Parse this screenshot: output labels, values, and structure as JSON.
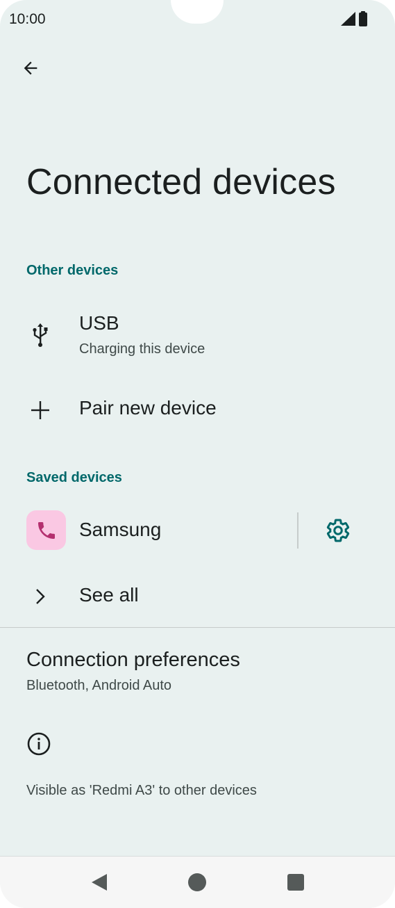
{
  "status_bar": {
    "time": "10:00",
    "icons": [
      "signal-icon",
      "battery-icon"
    ]
  },
  "header": {
    "back_icon": "arrow-left-icon",
    "title": "Connected devices"
  },
  "other_devices": {
    "header": "Other devices",
    "items": [
      {
        "title": "USB",
        "subtitle": "Charging this device",
        "icon": "usb-icon"
      },
      {
        "title": "Pair new device",
        "icon": "plus-icon"
      }
    ]
  },
  "saved_devices": {
    "header": "Saved devices",
    "device": {
      "name": "Samsung",
      "icon": "phone-icon",
      "settings_icon": "gear-icon"
    },
    "see_all": {
      "label": "See all",
      "icon": "chevron-right-icon"
    }
  },
  "connection_preferences": {
    "title": "Connection preferences",
    "subtitle": "Bluetooth, Android Auto"
  },
  "info": {
    "icon": "info-icon",
    "text": "Visible as 'Redmi A3' to other devices"
  },
  "colors": {
    "background": "#e9f1f0",
    "accent": "#00686a",
    "device_icon_bg": "#fac8e3",
    "device_icon_fg": "#b4306f"
  },
  "nav_bar": {
    "back": "nav-back-icon",
    "home": "nav-home-icon",
    "recents": "nav-recents-icon"
  }
}
